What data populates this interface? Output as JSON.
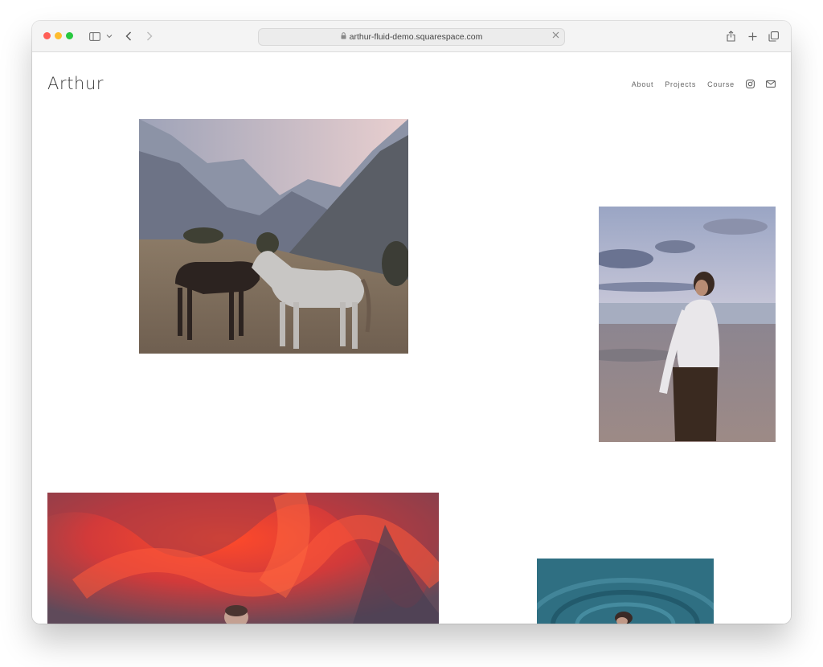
{
  "browser": {
    "url": "arthur-fluid-demo.squarespace.com",
    "icons": [
      "close-window-icon",
      "minimize-icon",
      "zoom-icon",
      "sidebar-icon",
      "chevron-down-icon",
      "back-icon",
      "forward-icon",
      "lock-icon",
      "clear-url-icon",
      "share-icon",
      "new-tab-icon",
      "tabs-icon"
    ]
  },
  "site": {
    "brand": "Arthur",
    "nav": [
      {
        "label": "About"
      },
      {
        "label": "Projects"
      },
      {
        "label": "Course"
      }
    ],
    "social_icons": [
      "instagram-icon",
      "mail-icon"
    ]
  },
  "gallery": [
    {
      "name": "photo-horses-mountains"
    },
    {
      "name": "photo-woman-beach"
    },
    {
      "name": "photo-red-sky"
    },
    {
      "name": "photo-swimmer-water"
    }
  ],
  "colors": {
    "accent_text": "#3a3a3a",
    "nav_text": "#666666",
    "traffic_red": "#ff5f57",
    "traffic_yellow": "#febc2e",
    "traffic_green": "#28c840"
  }
}
